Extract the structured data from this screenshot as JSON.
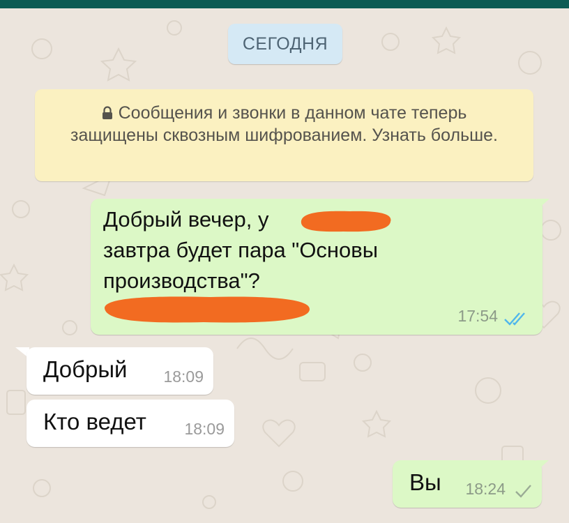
{
  "chat": {
    "date_label": "СЕГОДНЯ",
    "system_notice": "Сообщения и звонки в данном чате теперь защищены сквозным шифрованием. Узнать больше."
  },
  "messages": [
    {
      "direction": "outgoing",
      "text": "Добрый вечер, у \nзавтра будет пара \"Основы\nпроизводства\"?",
      "time": "17:54",
      "status": "read",
      "status_icon": "double-check-icon",
      "redacted": true
    },
    {
      "direction": "incoming",
      "text": "Добрый",
      "time": "18:09"
    },
    {
      "direction": "incoming",
      "text": "Кто ведет",
      "time": "18:09"
    },
    {
      "direction": "outgoing",
      "text": "Вы",
      "time": "18:24",
      "status": "sent",
      "status_icon": "single-check-icon"
    }
  ],
  "colors": {
    "wallpaper": "#ece5dd",
    "header": "#0d5b53",
    "outgoing_bubble": "#dcf8c6",
    "incoming_bubble": "#ffffff",
    "notice_bubble": "#fbf1c1",
    "date_chip": "#d5e9f5",
    "read_ticks": "#4fb6ec",
    "redaction_mark": "#f26b21"
  }
}
